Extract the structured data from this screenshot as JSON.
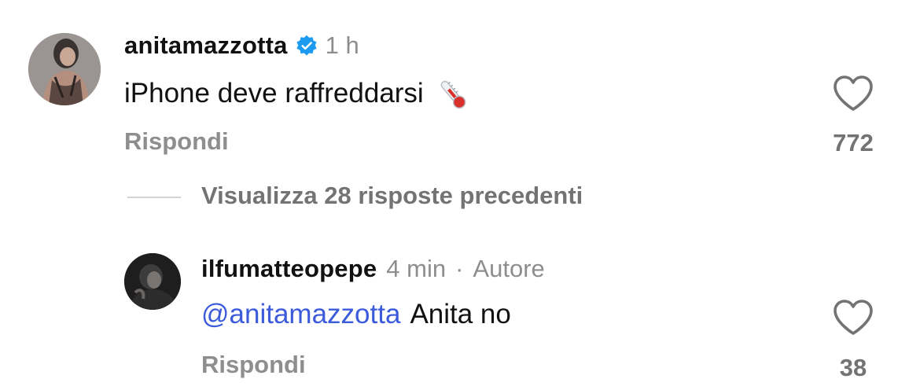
{
  "comments": [
    {
      "username": "anitamazzotta",
      "verified": true,
      "time": "1 h",
      "text": "iPhone deve raffreddarsi",
      "emoji": "thermometer-icon",
      "reply_label": "Rispondi",
      "like_count": "772"
    },
    {
      "username": "ilfumatteopepe",
      "time": "4 min",
      "separator": "·",
      "author_label": "Autore",
      "mention": "@anitamazzotta",
      "text": "Anita no",
      "reply_label": "Rispondi",
      "like_count": "38"
    }
  ],
  "view_replies_label": "Visualizza 28 risposte precedenti",
  "colors": {
    "verified_blue": "#1d9bf0",
    "mention_blue": "#3b5bdb",
    "muted_gray": "#8e8e8e"
  }
}
